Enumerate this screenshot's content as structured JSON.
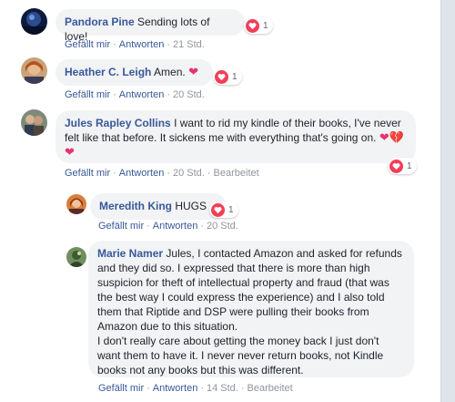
{
  "comments": [
    {
      "name": "Pandora Pine",
      "text": "Sending lots of love!",
      "like": "Gefällt mir",
      "reply": "Antworten",
      "time": "21 Std.",
      "reactions": "1",
      "edited": ""
    },
    {
      "name": "Heather C. Leigh",
      "text": "Amen.",
      "emoji": "❤",
      "like": "Gefällt mir",
      "reply": "Antworten",
      "time": "20 Std.",
      "reactions": "1",
      "edited": ""
    },
    {
      "name": "Jules Rapley Collins",
      "text": "I want to rid my kindle of their books, I've never felt like that before. It sickens me with everything that's going on.",
      "emoji": "❤💔❤",
      "like": "Gefällt mir",
      "reply": "Antworten",
      "time": "20 Std.",
      "reactions": "1",
      "edited": "Bearbeitet"
    },
    {
      "name": "Meredith King",
      "text": "HUGS",
      "like": "Gefällt mir",
      "reply": "Antworten",
      "time": "20 Std.",
      "reactions": "1",
      "edited": ""
    },
    {
      "name": "Marie Namer",
      "text": "Jules, I contacted Amazon and asked for refunds and they did so. I expressed that there is more than high suspicion for theft of intellectual property and fraud (that was the best way I could express the experience) and I also told them that Riptide and DSP were pulling their books from Amazon due to this situation.",
      "text2": "I don't really care about getting the money back I just don't want them to have it. I never never return books, not Kindle books not any books but this was different.",
      "like": "Gefällt mir",
      "reply": "Antworten",
      "time": "14 Std.",
      "reactions": "",
      "edited": "Bearbeitet"
    }
  ],
  "colors": {
    "link": "#385898",
    "bubble": "#f2f3f5",
    "love": "#f33e58"
  }
}
